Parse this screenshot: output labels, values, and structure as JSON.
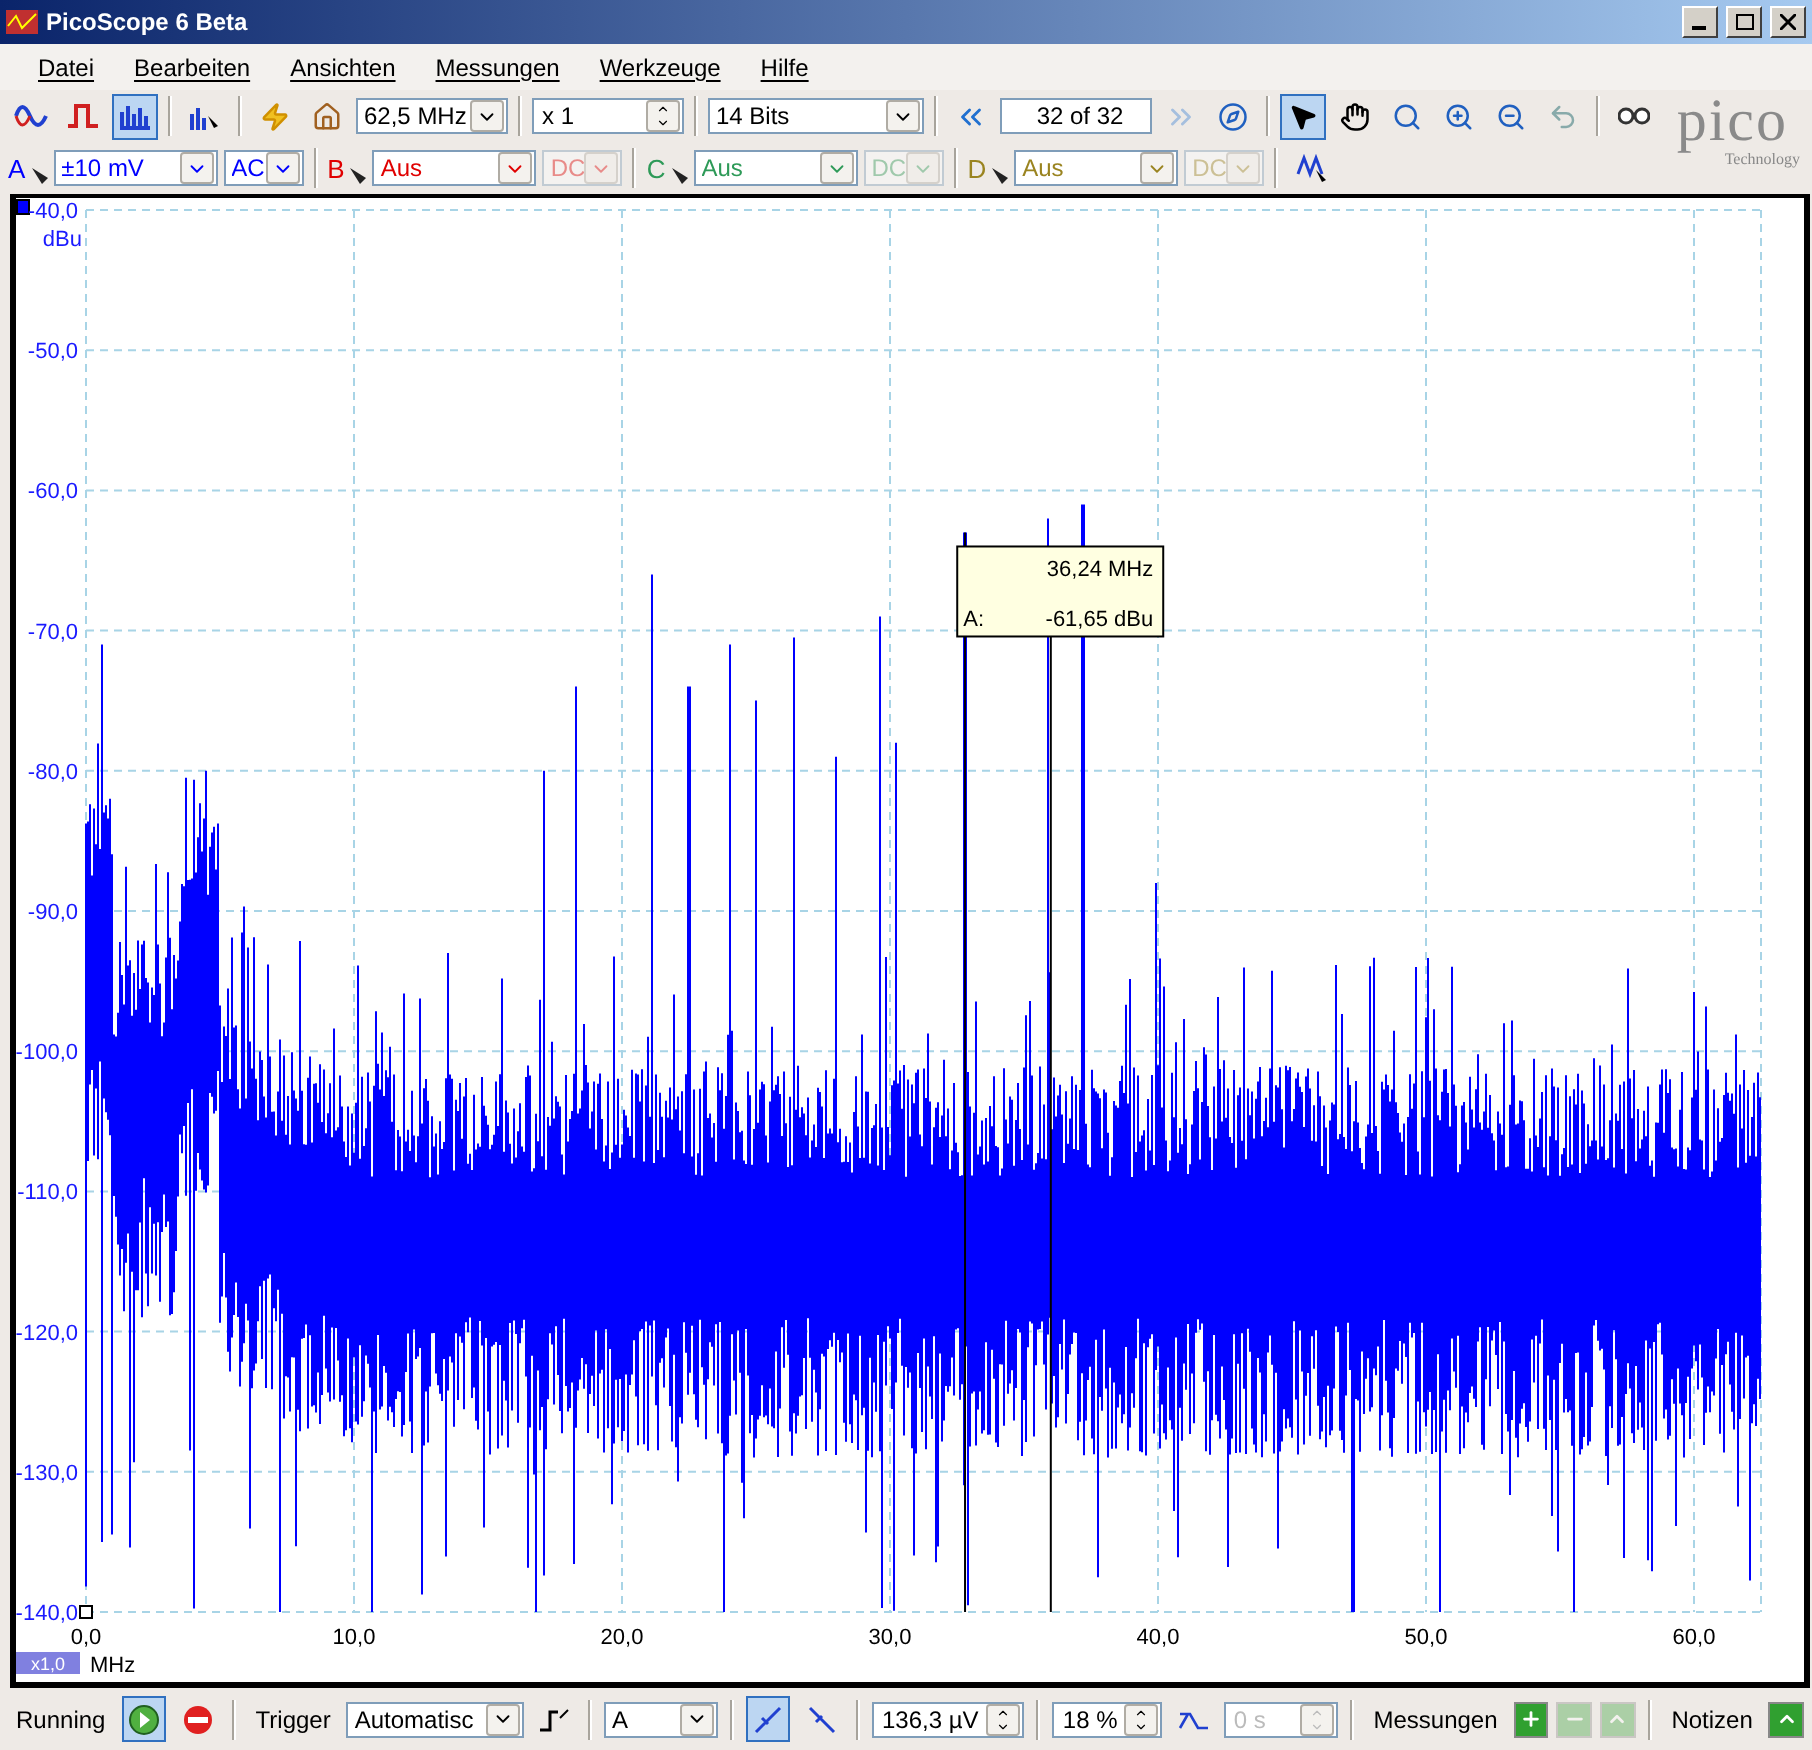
{
  "window": {
    "title": "PicoScope 6 Beta"
  },
  "menu": [
    "Datei",
    "Bearbeiten",
    "Ansichten",
    "Messungen",
    "Werkzeuge",
    "Hilfe"
  ],
  "toolbar": {
    "view_modes": [
      {
        "kind": "scope",
        "selected": false
      },
      {
        "kind": "persistence",
        "selected": false
      },
      {
        "kind": "spectrum",
        "selected": true
      }
    ],
    "timebase": "62,5 MHz",
    "multiplier": "x 1",
    "resolution": "14 Bits",
    "buffer": "32 of 32",
    "tools": [
      {
        "kind": "pointer",
        "selected": true
      },
      {
        "kind": "hand",
        "selected": false
      },
      {
        "kind": "zoom",
        "selected": false
      },
      {
        "kind": "zoom-in",
        "selected": false
      },
      {
        "kind": "zoom-out",
        "selected": false
      },
      {
        "kind": "undo",
        "selected": false
      }
    ],
    "logo": {
      "name": "pico",
      "subtitle": "Technology"
    }
  },
  "channels": [
    {
      "letter": "A",
      "range": "±10 mV",
      "coupling": "AC",
      "enabled": true,
      "color": "#0000ff"
    },
    {
      "letter": "B",
      "range": "Aus",
      "coupling": "DC",
      "enabled": false,
      "color": "#e00000"
    },
    {
      "letter": "C",
      "range": "Aus",
      "coupling": "DC",
      "enabled": false,
      "color": "#2e9a58"
    },
    {
      "letter": "D",
      "range": "Aus",
      "coupling": "DC",
      "enabled": false,
      "color": "#9a8420"
    }
  ],
  "plot": {
    "y_unit": "dBu",
    "y_ticks": [
      "-40,0",
      "-50,0",
      "-60,0",
      "-70,0",
      "-80,0",
      "-90,0",
      "-100,0",
      "-110,0",
      "-120,0",
      "-130,0",
      "-140,0"
    ],
    "x_unit": "MHz",
    "x_ticks": [
      "0,0",
      "10,0",
      "20,0",
      "30,0",
      "40,0",
      "50,0",
      "60,0"
    ],
    "zoom": "x1,0",
    "tooltip": {
      "frequency": "36,24 MHz",
      "channel": "A:",
      "value": "-61,65 dBu"
    }
  },
  "status_bar": {
    "state": "Running",
    "trigger_label": "Trigger",
    "trigger_mode": "Automatisc",
    "trigger_channel": "A",
    "threshold": "136,3 µV",
    "pretrigger": "18 %",
    "delay": "0 s",
    "delay_disabled": true,
    "measurements": "Messungen",
    "notes": "Notizen"
  }
}
